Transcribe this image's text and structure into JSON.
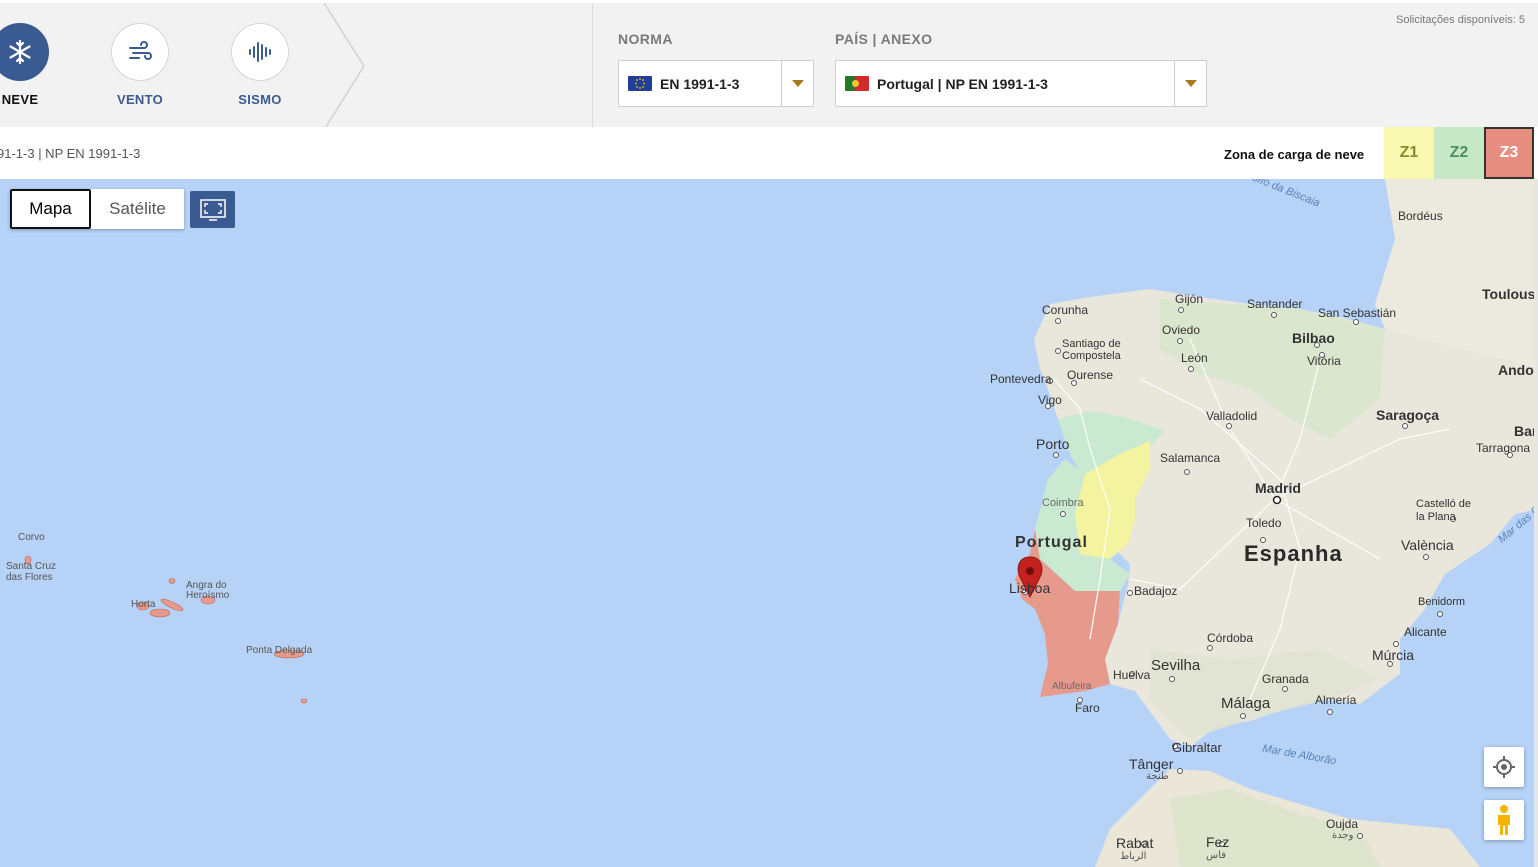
{
  "load_types": [
    {
      "label": "NEVE",
      "icon": "snowflake-icon",
      "active": true
    },
    {
      "label": "VENTO",
      "icon": "wind-icon",
      "active": false
    },
    {
      "label": "SISMO",
      "icon": "seismic-wave-icon",
      "active": false
    }
  ],
  "norma": {
    "title": "NORMA",
    "value": "EN 1991-1-3",
    "flag": "eu-flag-icon"
  },
  "pais": {
    "title": "PAÍS | ANEXO",
    "value": "Portugal | NP EN 1991-1-3",
    "flag": "portugal-flag-icon"
  },
  "requests_available": "Solicitações disponíveis: 5",
  "info": {
    "norm_crumb": "91-1-3  |  NP EN 1991-1-3",
    "zone_label": "Zona de carga de neve",
    "zones": [
      {
        "label": "Z1",
        "color": "#f9f8b0",
        "selected": false
      },
      {
        "label": "Z2",
        "color": "#c6e8c6",
        "selected": false
      },
      {
        "label": "Z3",
        "color": "#e58e80",
        "selected": true
      }
    ]
  },
  "map": {
    "type_buttons": {
      "map": "Mapa",
      "satellite": "Satélite"
    },
    "colors": {
      "sea": "#b6d3f7",
      "land": "#ece9df",
      "zone_z1": "#f4f3a0",
      "zone_z2": "#c9ead0",
      "zone_z3": "#e59a8c",
      "marker": "#c5221f"
    },
    "labels": {
      "golfo": "Golfo da Biscaia",
      "bordeus": "Bordéus",
      "toulouse": "Toulouse",
      "gijon": "Gijón",
      "santander": "Santander",
      "san_sebastian": "San Sebastián",
      "corunha": "Corunha",
      "oviedo": "Oviedo",
      "bilbao": "Bilbao",
      "vitoria": "Vitória",
      "andorra": "Andor",
      "santiago": "Santiago de\nCompostela",
      "leon": "León",
      "pontevedra": "Pontevedra",
      "ourense": "Ourense",
      "vigo": "Vigo",
      "valladolid": "Valladolid",
      "saragoca": "Saragoça",
      "barcelona": "Bar",
      "tarragona": "Tarragona",
      "porto": "Porto",
      "salamanca": "Salamanca",
      "madrid": "Madrid",
      "castello": "Castelló de\nla Plana",
      "coimbra": "Coimbra",
      "mar_das_baleares": "Mar das B",
      "toledo": "Toledo",
      "portugal": "Portugal",
      "espanha": "Espanha",
      "valencia": "València",
      "lisboa": "Lisboa",
      "badajoz": "Badajoz",
      "benidorm": "Benidorm",
      "alicante": "Alicante",
      "cordoba": "Córdoba",
      "murcia": "Múrcia",
      "huelva": "Huelva",
      "sevilha": "Sevilha",
      "granada": "Granada",
      "albufeira": "Albufeira",
      "faro": "Faro",
      "malaga": "Málaga",
      "almeria": "Almería",
      "gibraltar": "Gibraltar",
      "mar_de_alborao": "Mar de Alborão",
      "tanger": "Tânger",
      "tanger_ar": "طنجة",
      "oujda": "Oujda",
      "oujda_ar": "وجدة",
      "rabat": "Rabat",
      "rabat_ar": "الرباط",
      "fez": "Fez",
      "fez_ar": "فاس",
      "corvo": "Corvo",
      "santa_cruz": "Santa Cruz\ndas Flores",
      "horta": "Horta",
      "angra": "Angra do\nHeroísmo",
      "ponta_delgada": "Ponta Delgada"
    }
  }
}
